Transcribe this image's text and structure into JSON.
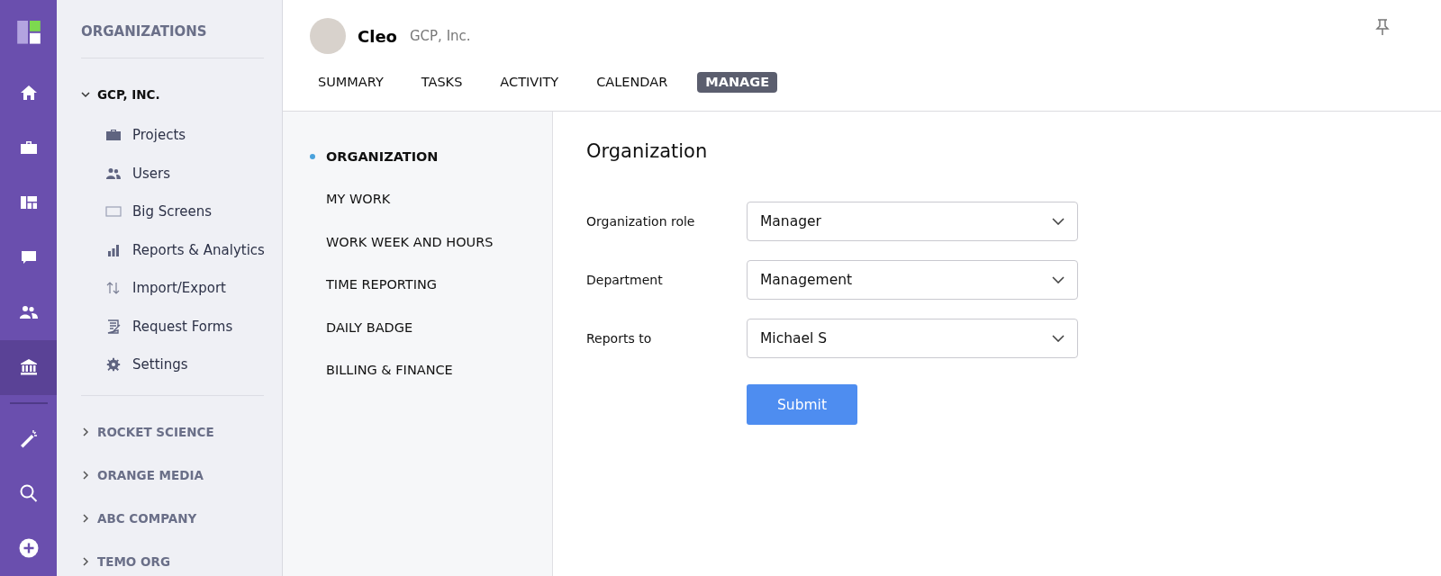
{
  "rail": {
    "items": [
      {
        "selected": false
      },
      {
        "selected": false
      },
      {
        "selected": false
      },
      {
        "selected": false
      },
      {
        "selected": false
      },
      {
        "selected": true
      },
      {
        "selected": false
      },
      {
        "selected": false
      },
      {
        "selected": false
      }
    ]
  },
  "sidebar": {
    "title": "ORGANIZATIONS",
    "organizations": [
      {
        "name": "GCP, INC.",
        "expanded": true,
        "items": [
          "Projects",
          "Users",
          "Big Screens",
          "Reports & Analytics",
          "Import/Export",
          "Request Forms",
          "Settings"
        ]
      },
      {
        "name": "ROCKET SCIENCE",
        "expanded": false
      },
      {
        "name": "ORANGE MEDIA",
        "expanded": false
      },
      {
        "name": "ABC COMPANY",
        "expanded": false
      },
      {
        "name": "TEMO ORG",
        "expanded": false
      }
    ]
  },
  "header": {
    "user": "Cleo",
    "organization": "GCP, Inc.",
    "tabs": [
      {
        "label": "SUMMARY",
        "selected": false
      },
      {
        "label": "TASKS",
        "selected": false
      },
      {
        "label": "ACTIVITY",
        "selected": false
      },
      {
        "label": "CALENDAR",
        "selected": false
      },
      {
        "label": "MANAGE",
        "selected": true
      }
    ]
  },
  "submenu": [
    {
      "label": "ORGANIZATION",
      "selected": true
    },
    {
      "label": "MY WORK",
      "selected": false
    },
    {
      "label": "WORK WEEK AND HOURS",
      "selected": false
    },
    {
      "label": "TIME REPORTING",
      "selected": false
    },
    {
      "label": "DAILY BADGE",
      "selected": false
    },
    {
      "label": "BILLING & FINANCE",
      "selected": false
    }
  ],
  "form": {
    "title": "Organization",
    "fields": [
      {
        "label": "Organization role",
        "value": "Manager"
      },
      {
        "label": "Department",
        "value": "Management"
      },
      {
        "label": "Reports to",
        "value": "Michael S"
      }
    ],
    "submit": "Submit"
  }
}
